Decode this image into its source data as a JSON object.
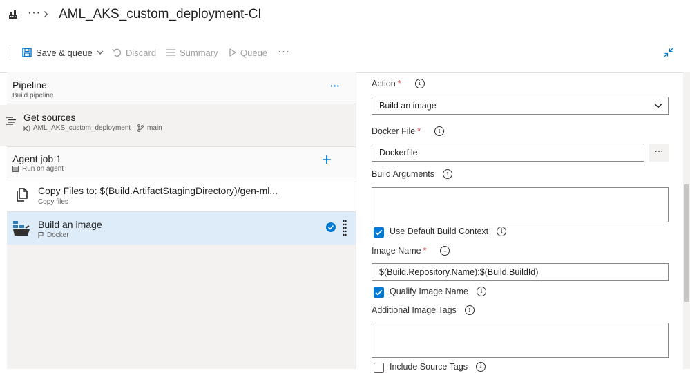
{
  "header": {
    "title": "AML_AKS_custom_deployment-CI",
    "more_glyph": "···",
    "chevron_glyph": "›"
  },
  "toolbar": {
    "save_queue_label": "Save & queue",
    "discard_label": "Discard",
    "summary_label": "Summary",
    "queue_label": "Queue",
    "more_glyph": "···"
  },
  "left": {
    "pipeline": {
      "title": "Pipeline",
      "subtitle": "Build pipeline",
      "more_glyph": "···"
    },
    "get_sources": {
      "title": "Get sources",
      "repo": "AML_AKS_custom_deployment",
      "branch": "main"
    },
    "agent_job": {
      "title": "Agent job 1",
      "subtitle": "Run on agent",
      "add_glyph": "+"
    },
    "tasks": [
      {
        "title": "Copy Files to: $(Build.ArtifactStagingDirectory)/gen-ml...",
        "subtitle": "Copy files",
        "selected": false
      },
      {
        "title": "Build an image",
        "subtitle": "Docker",
        "selected": true
      }
    ]
  },
  "form": {
    "action_label": "Action",
    "action_value": "Build an image",
    "docker_file_label": "Docker File",
    "docker_file_value": "Dockerfile",
    "browse_glyph": "···",
    "build_args_label": "Build Arguments",
    "use_default_context_label": "Use Default Build Context",
    "image_name_label": "Image Name",
    "image_name_value": "$(Build.Repository.Name):$(Build.BuildId)",
    "qualify_image_name_label": "Qualify Image Name",
    "additional_tags_label": "Additional Image Tags",
    "include_source_tags_label": "Include Source Tags",
    "required_mark": "*",
    "info_glyph": "i"
  },
  "colors": {
    "accent": "#0078d4",
    "selected_row": "#deecf9",
    "required": "#d13438"
  }
}
